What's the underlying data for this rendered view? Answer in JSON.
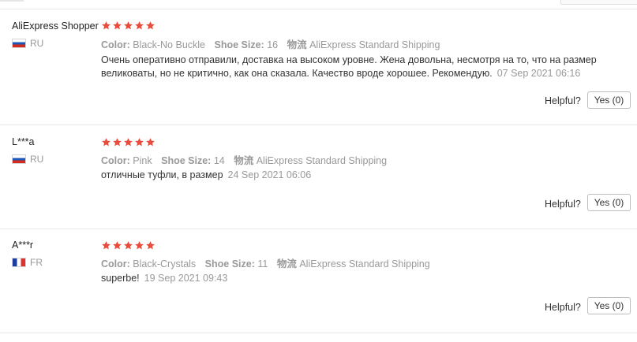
{
  "colors": {
    "star": "#e74c3c",
    "muted_text": "#999999",
    "body_text": "#333333",
    "divider": "#e8e8e8"
  },
  "labels": {
    "color": "Color:",
    "shoe_size": "Shoe Size:",
    "shipping": "物流",
    "helpful": "Helpful?"
  },
  "reviews": [
    {
      "user": "AliExpress Shopper",
      "country": "RU",
      "flag": "russia-flag-icon",
      "stars": 5,
      "color": "Black-No Buckle",
      "shoe_size": "16",
      "shipping": "AliExpress Standard Shipping",
      "text": "Очень оперативно отправили, доставка на высоком уровне. Жена довольна, несмотря на то, что на размер великоваты, но не критично, как она сказала. Качество вроде хорошее. Рекомендую.",
      "date": "07 Sep 2021 06:16",
      "yes_label": "Yes (0)"
    },
    {
      "user": "L***a",
      "country": "RU",
      "flag": "russia-flag-icon",
      "stars": 5,
      "color": "Pink",
      "shoe_size": "14",
      "shipping": "AliExpress Standard Shipping",
      "text": "отличные туфли, в размер",
      "date": "24 Sep 2021 06:06",
      "yes_label": "Yes (0)"
    },
    {
      "user": "A***r",
      "country": "FR",
      "flag": "france-flag-icon",
      "stars": 5,
      "color": "Black-Crystals",
      "shoe_size": "11",
      "shipping": "AliExpress Standard Shipping",
      "text": "superbe!",
      "date": "19 Sep 2021 09:43",
      "yes_label": "Yes (0)"
    }
  ]
}
